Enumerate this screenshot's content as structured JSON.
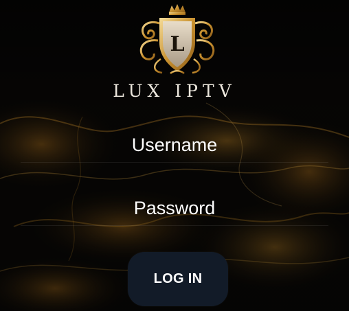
{
  "app": {
    "brand": "LUX IPTV",
    "logo_letter": "L",
    "logo_icon": "crest-shield-icon"
  },
  "form": {
    "username_placeholder": "Username",
    "username_value": "",
    "password_placeholder": "Password",
    "password_value": "",
    "login_label": "LOG IN"
  },
  "colors": {
    "background": "#070605",
    "gold": "#d9a441",
    "button": "#121b28",
    "text": "#ffffff"
  }
}
